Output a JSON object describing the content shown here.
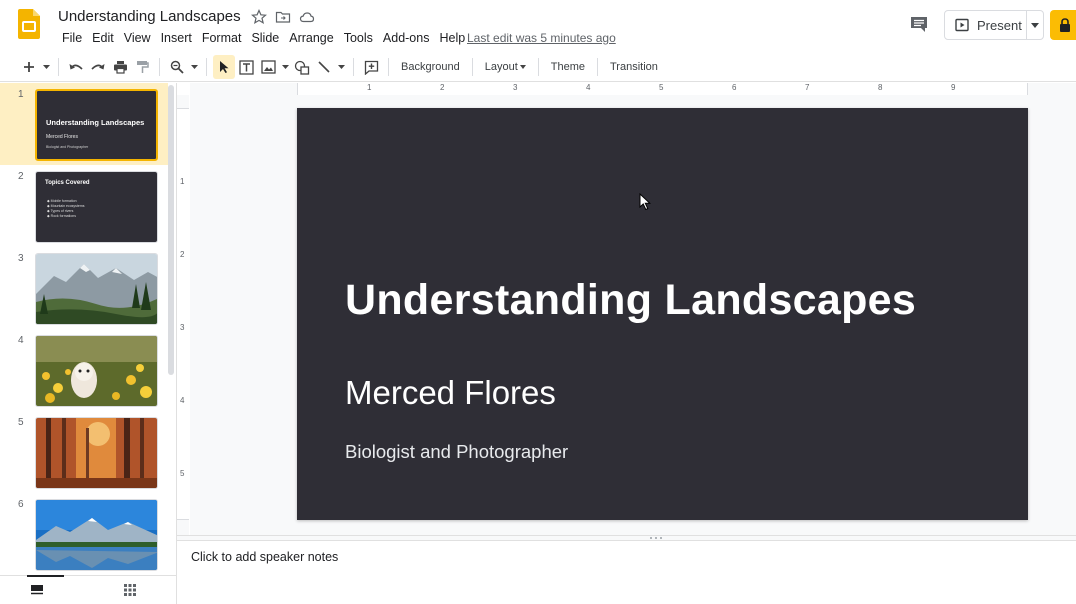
{
  "doc": {
    "title": "Understanding Landscapes",
    "last_edit": "Last edit was 5 minutes ago"
  },
  "menu": [
    "File",
    "Edit",
    "View",
    "Insert",
    "Format",
    "Slide",
    "Arrange",
    "Tools",
    "Add-ons",
    "Help"
  ],
  "header": {
    "present_label": "Present"
  },
  "toolbar": {
    "background_label": "Background",
    "layout_label": "Layout",
    "theme_label": "Theme",
    "transition_label": "Transition"
  },
  "filmstrip": {
    "slides": [
      {
        "number": "1",
        "title": "Understanding Landscapes",
        "subtitle": "Merced Flores",
        "body": "Biologist and Photographer"
      },
      {
        "number": "2",
        "title": "Topics Covered",
        "bullets": [
          "Mobile formation",
          "Mountain ecosystems",
          "Types of rivers",
          "Rock formations"
        ]
      },
      {
        "number": "3"
      },
      {
        "number": "4"
      },
      {
        "number": "5"
      },
      {
        "number": "6"
      }
    ]
  },
  "ruler": {
    "top": [
      "1",
      "2",
      "3",
      "4",
      "5",
      "6",
      "7",
      "8",
      "9"
    ],
    "left": [
      "1",
      "2",
      "3",
      "4",
      "5"
    ]
  },
  "slide": {
    "title": "Understanding Landscapes",
    "subtitle": "Merced Flores",
    "body": "Biologist and Photographer",
    "background": "#2f2e36"
  },
  "notes": {
    "placeholder": "Click to add speaker notes"
  },
  "colors": {
    "accent": "#fbbc04",
    "selected_thumb": "#feefc3",
    "slide_bg": "#2f2e36"
  }
}
